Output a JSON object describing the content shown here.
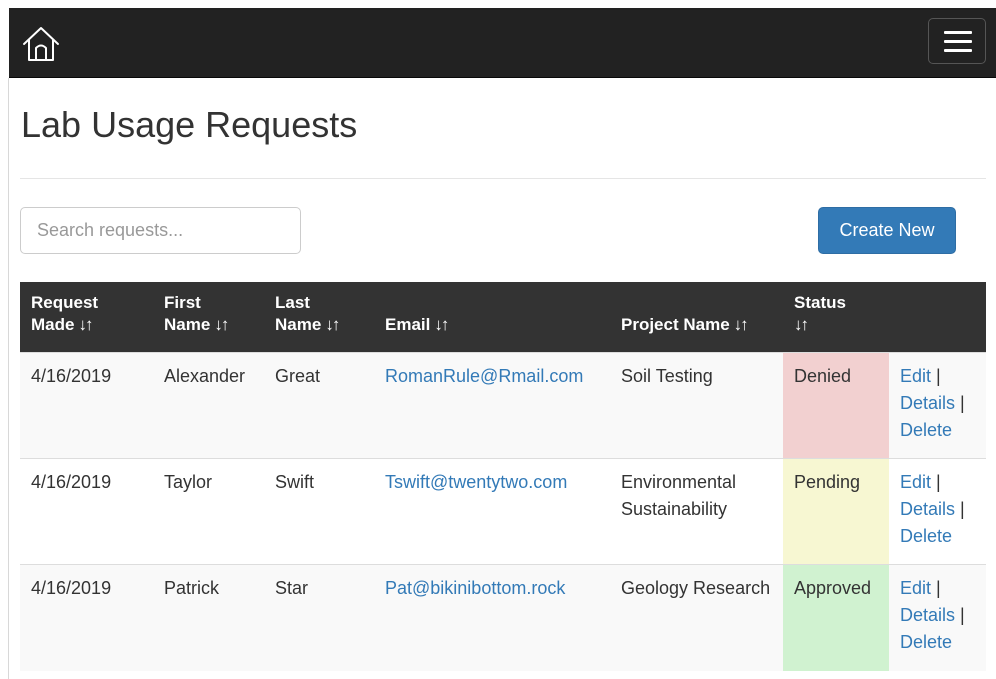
{
  "navbar": {
    "home_icon": "home-icon",
    "menu_icon": "hamburger-menu-icon"
  },
  "page": {
    "title": "Lab Usage Requests"
  },
  "search": {
    "placeholder": "Search requests..."
  },
  "toolbar": {
    "create_label": "Create New"
  },
  "table": {
    "sort_glyph": "↓↑",
    "headers": {
      "request_made_line1": "Request",
      "request_made_line2": "Made",
      "first_name_line1": "First",
      "first_name_line2": "Name",
      "last_name_line1": "Last",
      "last_name_line2": "Name",
      "email": "Email",
      "project_name": "Project Name",
      "status": "Status"
    },
    "rows": [
      {
        "date": "4/16/2019",
        "first": "Alexander",
        "last": "Great",
        "email": "RomanRule@Rmail.com",
        "project": "Soil Testing",
        "status": "Denied",
        "status_color": "#f2d0d0"
      },
      {
        "date": "4/16/2019",
        "first": "Taylor",
        "last": "Swift",
        "email": "Tswift@twentytwo.com",
        "project": "Environmental Sustainability",
        "status": "Pending",
        "status_color": "#f7f7d2"
      },
      {
        "date": "4/16/2019",
        "first": "Patrick",
        "last": "Star",
        "email": "Pat@bikinibottom.rock",
        "project": "Geology Research",
        "status": "Approved",
        "status_color": "#d0f2d0"
      }
    ],
    "actions": {
      "edit": "Edit",
      "details": "Details",
      "delete": "Delete",
      "separator": "|"
    }
  },
  "colors": {
    "navbar_bg": "#222222",
    "header_bg": "#333333",
    "link": "#337ab7",
    "primary_button": "#337ab7"
  }
}
